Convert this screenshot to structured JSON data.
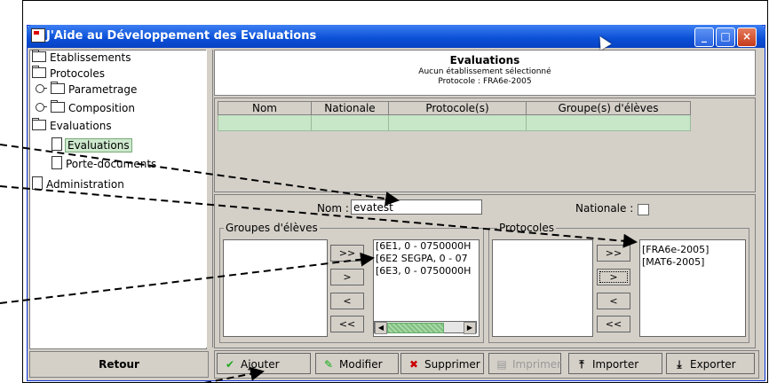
{
  "window": {
    "title": "J'Aide au Développement des Evaluations",
    "minimize": "_",
    "maximize": "□",
    "close": "×"
  },
  "tree": {
    "items": [
      "Etablissements",
      "Protocoles",
      "Parametrage",
      "Composition",
      "Evaluations",
      "Evaluations",
      "Porte-documents",
      "Administration"
    ]
  },
  "retour_label": "Retour",
  "header": {
    "title": "Evaluations",
    "subtitle": "Aucun établissement sélectionné",
    "protocol": "Protocole : FRA6e-2005"
  },
  "table": {
    "columns": [
      "Nom",
      "Nationale",
      "Protocole(s)",
      "Groupe(s) d'élèves"
    ]
  },
  "form": {
    "nom_label": "Nom :",
    "nom_value": "evatest",
    "nationale_label": "Nationale :",
    "groupes_label": "Groupes d'élèves",
    "protocoles_label": "Protocoles",
    "groupes_available": [
      "[6E1, 0 - 0750000H",
      "[6E2 SEGPA, 0 - 07",
      "[6E3, 0 - 0750000H"
    ],
    "protocoles_available": [
      "[FRA6e-2005]",
      "[MAT6-2005]"
    ],
    "btn_all_right": ">>",
    "btn_right": ">",
    "btn_left": "<",
    "btn_all_left": "<<"
  },
  "toolbar": {
    "ajouter": "Ajouter",
    "modifier": "Modifier",
    "supprimer": "Supprimer",
    "imprimer": "Imprimer",
    "importer": "Importer",
    "exporter": "Exporter"
  },
  "colors": {
    "title_bar": "#0a4fd6",
    "selection_green": "#c8e6c8"
  }
}
